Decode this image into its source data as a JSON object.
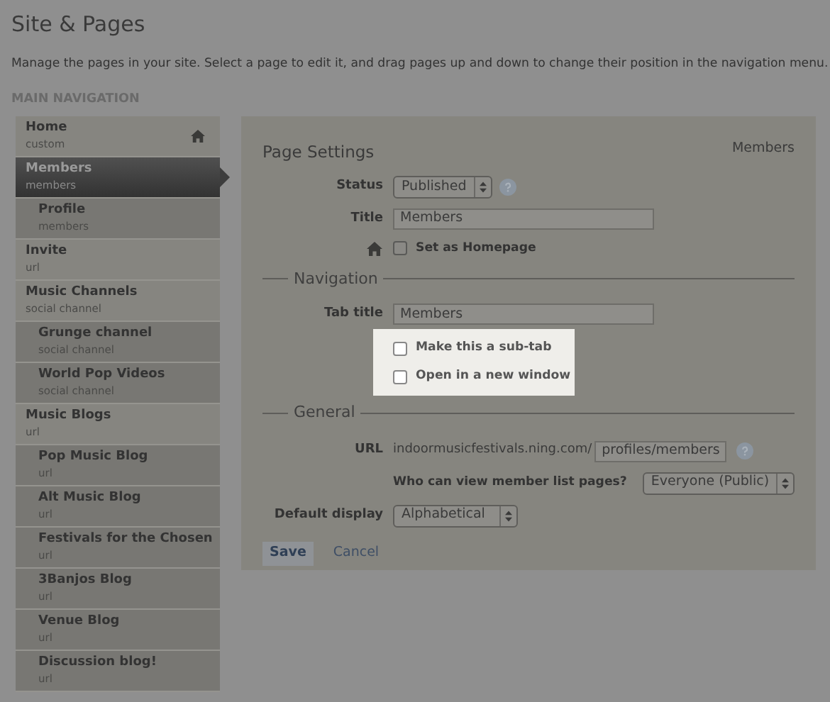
{
  "page": {
    "title": "Site & Pages",
    "description": "Manage the pages in your site. Select a page to edit it, and drag pages up and down to change their position in the navigation menu."
  },
  "sidebar": {
    "heading": "MAIN NAVIGATION",
    "items": [
      {
        "label": "Home",
        "type": "custom",
        "selected": false,
        "is_homepage": true
      },
      {
        "label": "Members",
        "type": "members",
        "selected": true,
        "is_homepage": false,
        "children": [
          {
            "label": "Profile",
            "type": "members",
            "selected": false
          }
        ]
      },
      {
        "label": "Invite",
        "type": "url",
        "selected": false,
        "is_homepage": false
      },
      {
        "label": "Music Channels",
        "type": "social channel",
        "selected": false,
        "is_homepage": false,
        "children": [
          {
            "label": "Grunge channel",
            "type": "social channel",
            "selected": false
          },
          {
            "label": "World Pop Videos",
            "type": "social channel",
            "selected": false
          }
        ]
      },
      {
        "label": "Music Blogs",
        "type": "url",
        "selected": false,
        "is_homepage": false,
        "children": [
          {
            "label": "Pop Music Blog",
            "type": "url",
            "selected": false
          },
          {
            "label": "Alt Music Blog",
            "type": "url",
            "selected": false
          },
          {
            "label": "Festivals for the Chosen",
            "type": "url",
            "selected": false
          },
          {
            "label": "3Banjos Blog",
            "type": "url",
            "selected": false
          },
          {
            "label": "Venue Blog",
            "type": "url",
            "selected": false
          },
          {
            "label": "Discussion blog!",
            "type": "url",
            "selected": false
          }
        ]
      }
    ]
  },
  "settings": {
    "title": "Page Settings",
    "page_name": "Members",
    "status": {
      "label": "Status",
      "value": "Published"
    },
    "title_field": {
      "label": "Title",
      "value": "Members"
    },
    "homepage_checkbox": {
      "label": "Set as Homepage",
      "checked": false
    },
    "navigation": {
      "legend": "Navigation",
      "tab_title": {
        "label": "Tab title",
        "value": "Members"
      },
      "spotlight": true,
      "options": [
        {
          "label": "Make this a sub-tab",
          "checked": false
        },
        {
          "label": "Open in a new window",
          "checked": false
        }
      ]
    },
    "general": {
      "legend": "General",
      "url": {
        "label": "URL",
        "prefix": "indoormusicfestivals.ning.com/",
        "value": "profiles/members"
      },
      "visibility": {
        "label": "Who can view member list pages?",
        "value": "Everyone (Public)"
      },
      "default_display": {
        "label": "Default display",
        "value": "Alphabetical"
      }
    },
    "buttons": [
      {
        "label": "Save",
        "kind": "primary"
      },
      {
        "label": "Cancel",
        "kind": "link"
      }
    ]
  }
}
